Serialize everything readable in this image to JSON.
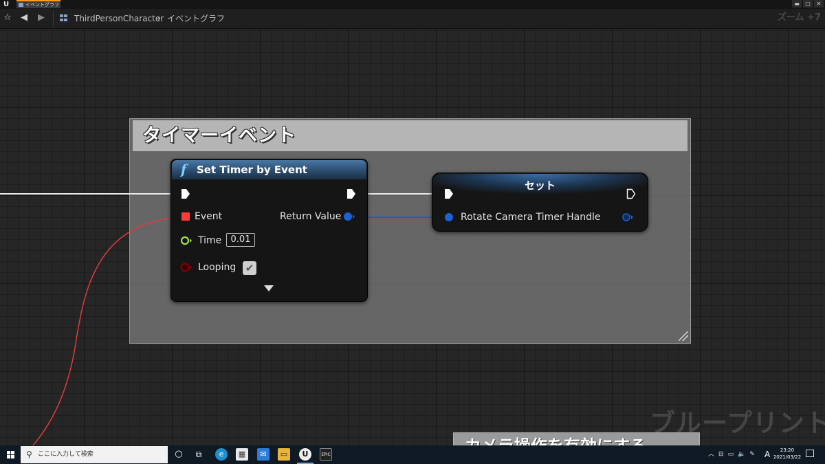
{
  "window": {
    "logo_text": "U",
    "tab_label": "イベントグラフ",
    "controls": [
      "▬",
      "▢",
      "✕"
    ]
  },
  "toolbar": {
    "breadcrumb": [
      "ThirdPersonCharacter",
      "イベントグラフ"
    ],
    "breadcrumb_separator": "›",
    "zoom_label": "ズーム +7"
  },
  "graph": {
    "comment_title": "タイマーイベント",
    "timer_node": {
      "icon": "f",
      "title": "Set Timer by Event",
      "pins": {
        "event": "Event",
        "return_value": "Return Value",
        "time": "Time",
        "time_value": "0.01",
        "looping": "Looping",
        "looping_checked": true
      }
    },
    "set_node": {
      "title": "セット",
      "pin": "Rotate Camera Timer Handle"
    },
    "bottom_comment_title": "カメラ操作を有効にする",
    "watermark": "ブループリント"
  },
  "colors": {
    "exec_pin": "#ffffff",
    "delegate_pin": "#ff3a3a",
    "float_pin": "#9ee449",
    "bool_pin": "#8a0000",
    "struct_pin": "#1a62d6",
    "wire_delegate": "#e03c3c",
    "wire_struct": "#1a5fd0"
  },
  "taskbar": {
    "search_placeholder": "ここに入力して検索",
    "search_icon": "search-icon",
    "tray_ime": "A",
    "clock_time": "23:20",
    "clock_date": "2021/03/22"
  }
}
